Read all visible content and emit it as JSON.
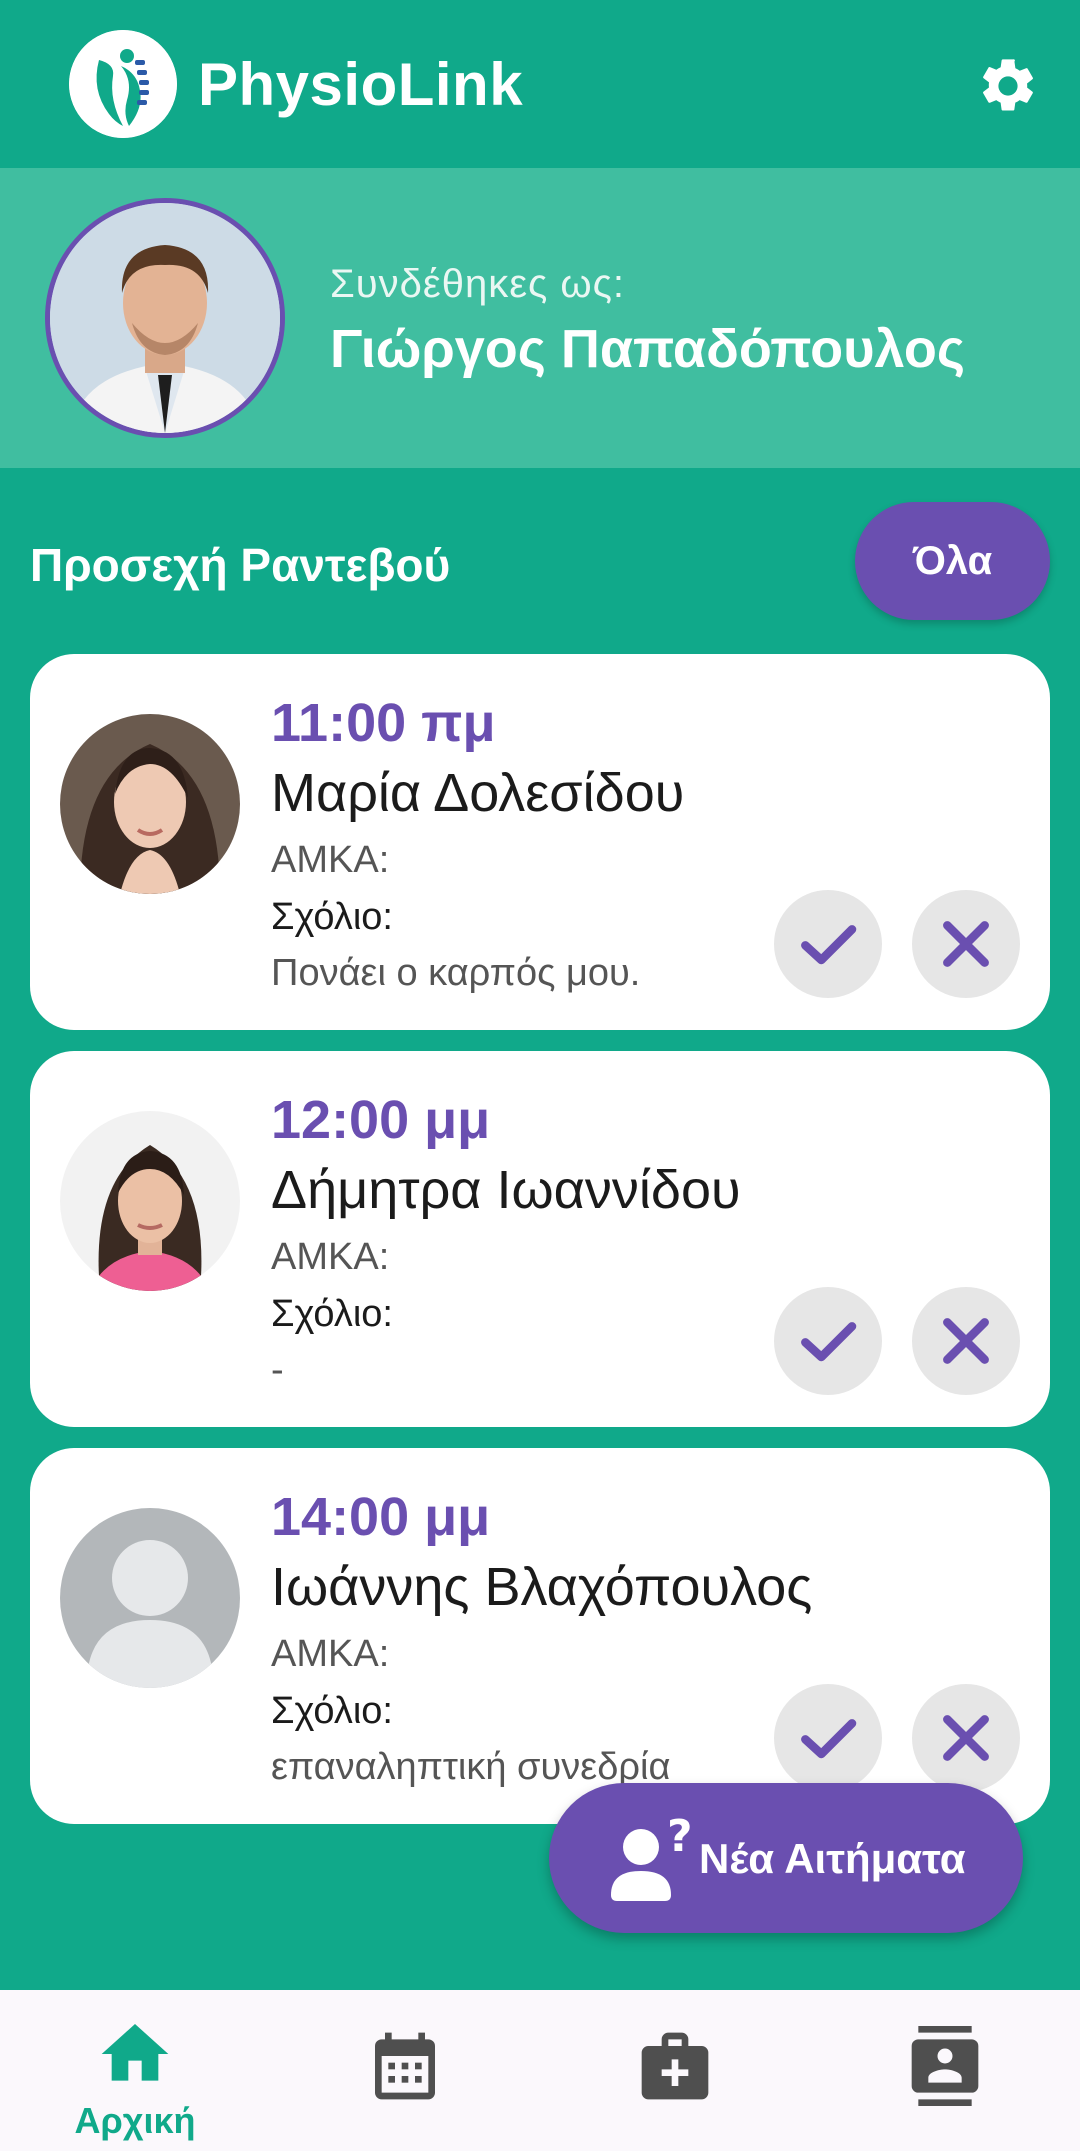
{
  "app": {
    "title": "PhysioLink"
  },
  "profile": {
    "signed_in_label": "Συνδέθηκες ως:",
    "name": "Γιώργος Παπαδόπουλος"
  },
  "appointments": {
    "section_title": "Προσεχή Ραντεβού",
    "all_button": "Όλα",
    "items": [
      {
        "time": "11:00 πμ",
        "patient": "Μαρία Δολεσίδου",
        "amka_label": "ΑΜΚΑ:",
        "comment_label": "Σχόλιο:",
        "comment": "Πονάει ο καρπός μου."
      },
      {
        "time": "12:00 μμ",
        "patient": "Δήμητρα Ιωαννίδου",
        "amka_label": "ΑΜΚΑ:",
        "comment_label": "Σχόλιο:",
        "comment": "-"
      },
      {
        "time": "14:00 μμ",
        "patient": "Ιωάννης Βλαχόπουλος",
        "amka_label": "ΑΜΚΑ:",
        "comment_label": "Σχόλιο:",
        "comment": "επαναληπτική συνεδρία"
      }
    ]
  },
  "fab": {
    "label": "Νέα Αιτήματα",
    "icon": "person-question-icon"
  },
  "bottom_nav": {
    "items": [
      {
        "icon": "home-icon",
        "label": "Αρχική",
        "active": true
      },
      {
        "icon": "calendar-icon",
        "label": ""
      },
      {
        "icon": "medical-kit-icon",
        "label": ""
      },
      {
        "icon": "contacts-icon",
        "label": ""
      }
    ]
  },
  "colors": {
    "primary": "#10a98a",
    "profile_band": "#40bea0",
    "accent": "#6a4fb0",
    "icon_gray": "#4f4f4f"
  }
}
